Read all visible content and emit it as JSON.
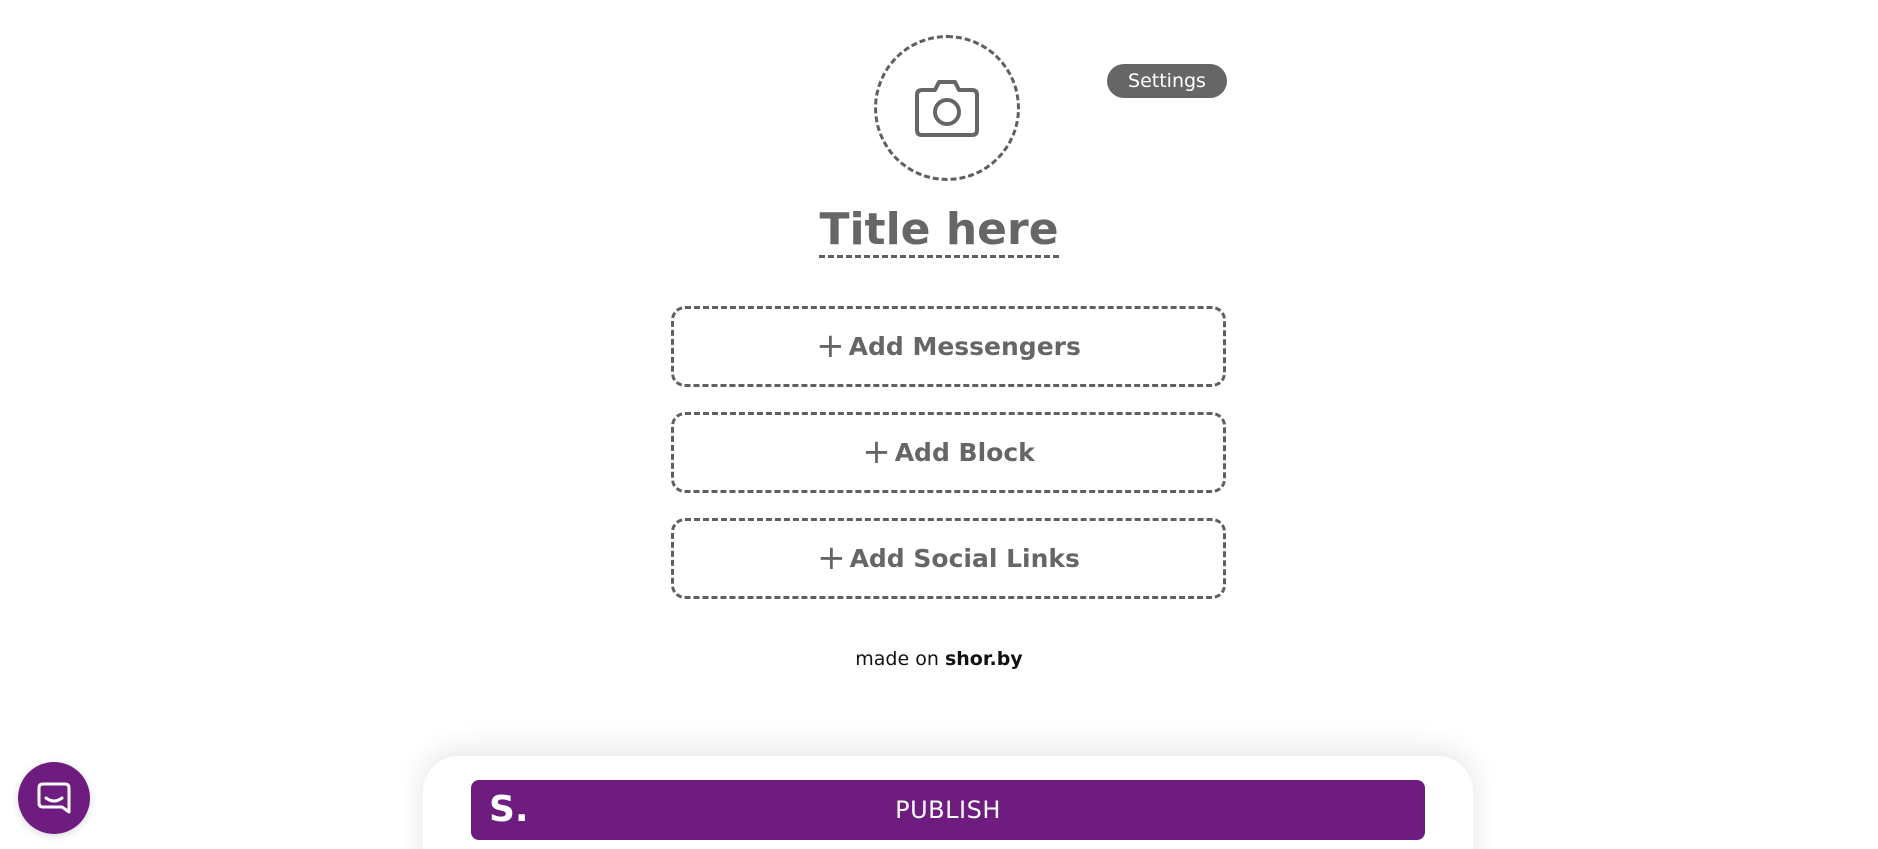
{
  "header": {
    "avatar_icon": "camera-icon",
    "settings_label": "Settings"
  },
  "profile": {
    "title": "Title here"
  },
  "actions": {
    "plus_icon": "plus-icon",
    "add_messengers_label": "Add Messengers",
    "add_block_label": "Add Block",
    "add_social_links_label": "Add Social Links"
  },
  "footer": {
    "made_on_prefix": "made on",
    "brand_link": "shor.by"
  },
  "publish": {
    "logo": "S.",
    "label": "PUBLISH"
  },
  "chat": {
    "icon": "chat-icon"
  },
  "colors": {
    "accent": "#6e1c80",
    "text_gray": "#666666",
    "border_gray": "#5f5f5f",
    "background": "#ffffff"
  }
}
